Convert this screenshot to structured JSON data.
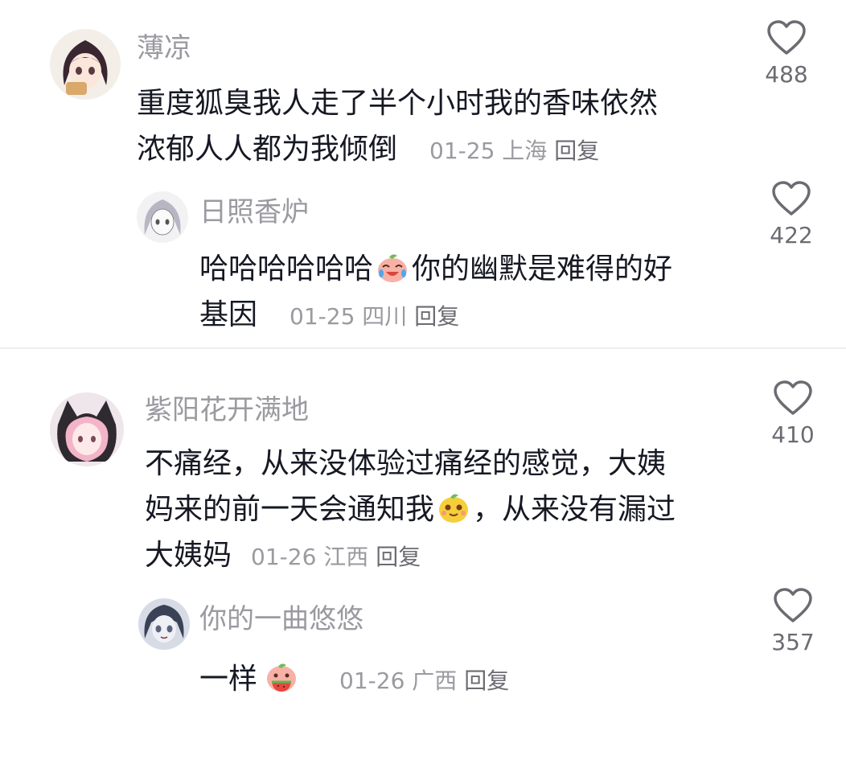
{
  "comments": [
    {
      "username": "薄凉",
      "text_1": "重度狐臭我人走了半个小时我的香味依然",
      "text_2": "浓郁人人都为我倾倒",
      "date": "01-25",
      "location": "上海",
      "reply": "回复",
      "likes": "488",
      "avatar_icon": "anime-girl-avatar",
      "reply_thread": {
        "username": "日照香炉",
        "text_1a": "哈哈哈哈哈哈",
        "emoji": "crying-laughing-peach-emoji",
        "text_1b": "你的幽默是难得的好",
        "text_2": "基因",
        "date": "01-25",
        "location": "四川",
        "reply": "回复",
        "likes": "422"
      }
    },
    {
      "username": "紫阳花开满地",
      "text_1": "不痛经，从来没体验过痛经的感觉，大姨",
      "text_2a": "妈来的前一天会通知我",
      "emoji": "yellow-smile-emoji",
      "text_2b": "，从来没有漏过",
      "text_3": "大姨妈",
      "date": "01-26",
      "location": "江西",
      "reply": "回复",
      "likes": "410",
      "avatar_icon": "pink-hair-girl-avatar",
      "reply_thread": {
        "username": "你的一曲悠悠",
        "text": "一样",
        "emoji": "watermelon-peach-emoji",
        "date": "01-26",
        "location": "广西",
        "reply": "回复",
        "likes": "357"
      }
    }
  ],
  "colors": {
    "username": "#9a9aa0",
    "text": "#161823",
    "meta": "#9a9aa0",
    "like_icon": "#6b6b72"
  }
}
